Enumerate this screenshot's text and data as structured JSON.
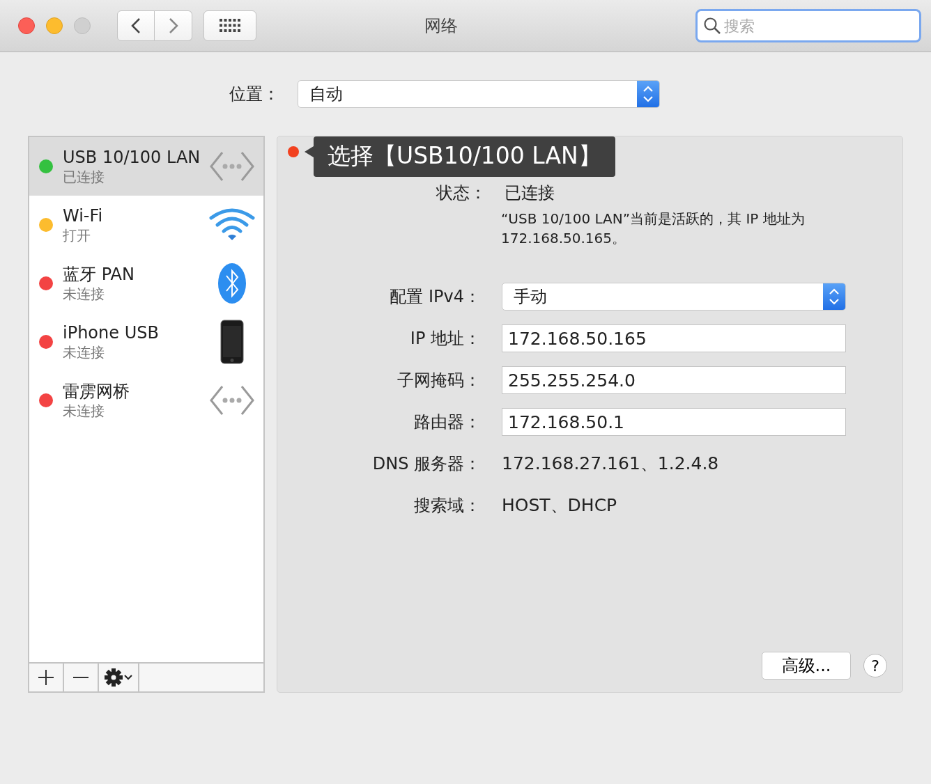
{
  "window": {
    "title": "网络",
    "search": {
      "placeholder": "搜索"
    }
  },
  "location": {
    "label": "位置：",
    "value": "自动"
  },
  "services": [
    {
      "name": "USB 10/100 LAN",
      "status": "已连接",
      "color": "#34c140",
      "selected": true,
      "kind": "ethernet"
    },
    {
      "name": "Wi-Fi",
      "status": "打开",
      "color": "#fcbc2e",
      "selected": false,
      "kind": "wifi"
    },
    {
      "name": "蓝牙 PAN",
      "status": "未连接",
      "color": "#f34343",
      "selected": false,
      "kind": "bluetooth"
    },
    {
      "name": "iPhone USB",
      "status": "未连接",
      "color": "#f34343",
      "selected": false,
      "kind": "iphone"
    },
    {
      "name": "雷雳网桥",
      "status": "未连接",
      "color": "#f34343",
      "selected": false,
      "kind": "ethernet"
    }
  ],
  "details": {
    "status_label": "状态：",
    "status_value": "已连接",
    "tooltip": "选择【USB10/100 LAN】",
    "description": "“USB 10/100 LAN”当前是活跃的，其 IP 地址为 172.168.50.165。",
    "fields": [
      {
        "label": "配置 IPv4：",
        "value": "手动",
        "kind": "popup"
      },
      {
        "label": "IP 地址：",
        "value": "172.168.50.165",
        "kind": "text"
      },
      {
        "label": "子网掩码：",
        "value": "255.255.254.0",
        "kind": "text"
      },
      {
        "label": "路由器：",
        "value": "172.168.50.1",
        "kind": "text"
      },
      {
        "label": "DNS 服务器：",
        "value": "172.168.27.161、1.2.4.8",
        "kind": "static"
      },
      {
        "label": "搜索域：",
        "value": "HOST、DHCP",
        "kind": "static"
      }
    ],
    "advanced_button": "高级...",
    "help_button": "?"
  }
}
